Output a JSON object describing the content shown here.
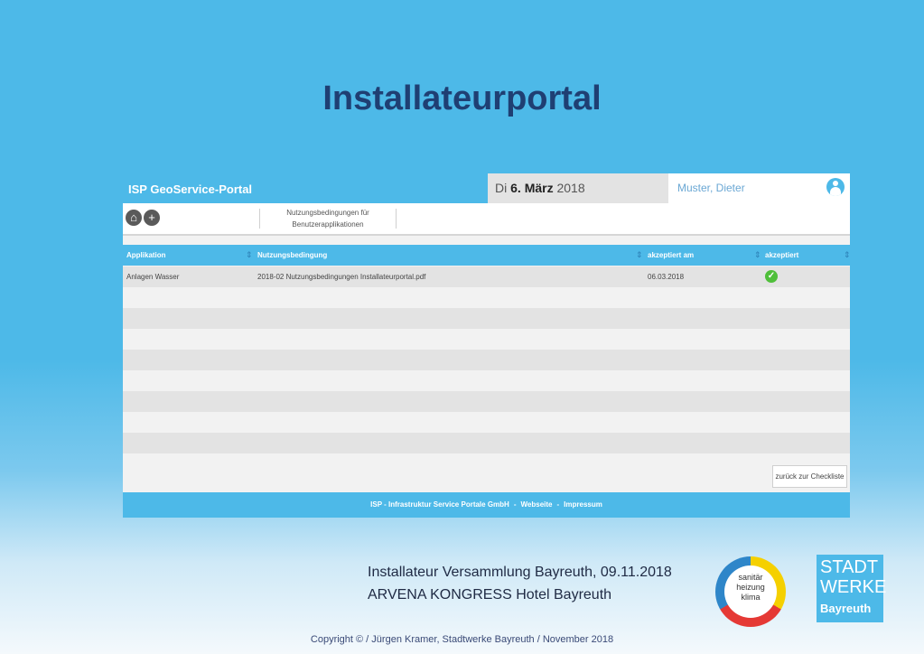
{
  "slide": {
    "title": "Installateurportal",
    "event_line1": "Installateur Versammlung Bayreuth, 09.11.2018",
    "event_line2": "ARVENA KONGRESS Hotel Bayreuth",
    "copyright": "Copyright © / Jürgen Kramer, Stadtwerke Bayreuth / November 2018"
  },
  "portal": {
    "brand": "ISP GeoService-Portal",
    "date_prefix": "Di",
    "date_bold": "6. März",
    "date_year": "2018",
    "user": "Muster, Dieter",
    "toolbar": {
      "home": "⌂",
      "add": "+",
      "menu_line1": "Nutzungsbedingungen für",
      "menu_line2": "Benutzerapplikationen"
    },
    "table": {
      "headers": [
        "Applikation",
        "Nutzungsbedingung",
        "akzeptiert am",
        "akzeptiert"
      ],
      "sort_icon": "⇕",
      "rows": [
        {
          "applikation": "Anlagen Wasser",
          "nutzungsbedingung": "2018-02 Nutzungsbedingungen Installateurportal.pdf",
          "akzeptiert_am": "06.03.2018",
          "akzeptiert": "✓"
        }
      ],
      "empty_rows": 8
    },
    "back_button": "zurück zur Checkliste",
    "footer": {
      "company": "ISP - Infrastruktur Service Portale GmbH",
      "link1": "Webseite",
      "link2": "Impressum",
      "dash": "-"
    }
  },
  "logos": {
    "shk_line1": "sanitär",
    "shk_line2": "heizung",
    "shk_line3": "klima",
    "sw_line1": "STADT",
    "sw_line2": "WERKE",
    "sw_line3": "Bayreuth"
  },
  "colors": {
    "background": "#4db9e8",
    "title": "#1f3f73",
    "check": "#4fbf3a"
  }
}
